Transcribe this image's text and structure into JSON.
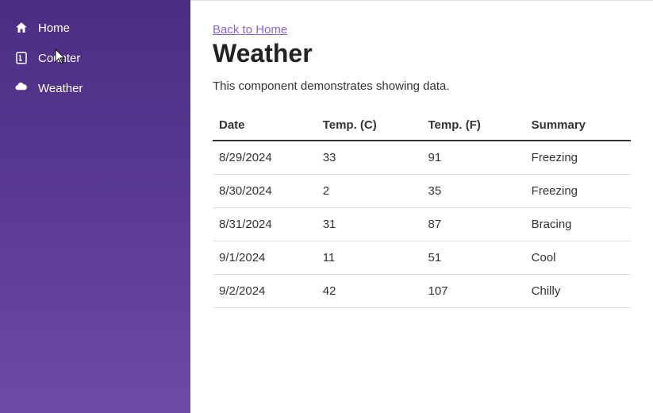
{
  "sidebar": {
    "items": [
      {
        "label": "Home",
        "icon": "home-icon"
      },
      {
        "label": "Counter",
        "icon": "counter-icon"
      },
      {
        "label": "Weather",
        "icon": "weather-icon"
      }
    ]
  },
  "main": {
    "back_link": "Back to Home",
    "title": "Weather",
    "description": "This component demonstrates showing data.",
    "table": {
      "headers": [
        "Date",
        "Temp. (C)",
        "Temp. (F)",
        "Summary"
      ],
      "rows": [
        [
          "8/29/2024",
          "33",
          "91",
          "Freezing"
        ],
        [
          "8/30/2024",
          "2",
          "35",
          "Freezing"
        ],
        [
          "8/31/2024",
          "31",
          "87",
          "Bracing"
        ],
        [
          "9/1/2024",
          "11",
          "51",
          "Cool"
        ],
        [
          "9/2/2024",
          "42",
          "107",
          "Chilly"
        ]
      ]
    }
  }
}
